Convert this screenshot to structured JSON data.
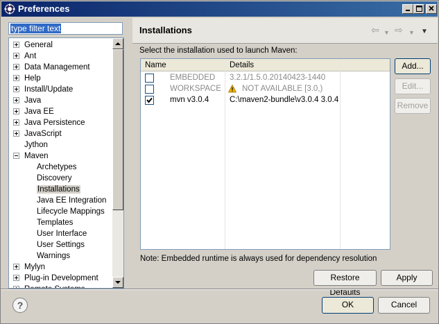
{
  "window": {
    "title": "Preferences"
  },
  "filter": {
    "value": "type filter text"
  },
  "tree": {
    "items": [
      {
        "label": "General",
        "expander": "plus"
      },
      {
        "label": "Ant",
        "expander": "plus"
      },
      {
        "label": "Data Management",
        "expander": "plus"
      },
      {
        "label": "Help",
        "expander": "plus"
      },
      {
        "label": "Install/Update",
        "expander": "plus"
      },
      {
        "label": "Java",
        "expander": "plus"
      },
      {
        "label": "Java EE",
        "expander": "plus"
      },
      {
        "label": "Java Persistence",
        "expander": "plus"
      },
      {
        "label": "JavaScript",
        "expander": "plus"
      },
      {
        "label": "Jython",
        "expander": "none"
      },
      {
        "label": "Maven",
        "expander": "minus"
      },
      {
        "label": "Archetypes",
        "expander": "child"
      },
      {
        "label": "Discovery",
        "expander": "child"
      },
      {
        "label": "Installations",
        "expander": "child",
        "selected": true
      },
      {
        "label": "Java EE Integration",
        "expander": "child"
      },
      {
        "label": "Lifecycle Mappings",
        "expander": "child"
      },
      {
        "label": "Templates",
        "expander": "child"
      },
      {
        "label": "User Interface",
        "expander": "child"
      },
      {
        "label": "User Settings",
        "expander": "child"
      },
      {
        "label": "Warnings",
        "expander": "child"
      },
      {
        "label": "Mylyn",
        "expander": "plus"
      },
      {
        "label": "Plug-in Development",
        "expander": "plus"
      },
      {
        "label": "Remote Systems",
        "expander": "plus"
      }
    ]
  },
  "page": {
    "title": "Installations",
    "instruction": "Select the installation used to launch Maven:",
    "note": "Note: Embedded runtime is always used for dependency resolution"
  },
  "table": {
    "columns": [
      "Name",
      "Details"
    ],
    "rows": [
      {
        "name": "EMBEDDED",
        "details": "3.2.1/1.5.0.20140423-1440",
        "checked": false,
        "gray": true,
        "warning": false
      },
      {
        "name": "WORKSPACE",
        "details": "NOT AVAILABLE [3.0,)",
        "checked": false,
        "gray": true,
        "warning": true
      },
      {
        "name": "mvn v3.0.4",
        "details": "C:\\maven2-bundle\\v3.0.4 3.0.4",
        "checked": true,
        "gray": false,
        "warning": false
      }
    ]
  },
  "buttons": {
    "add": "Add...",
    "edit": "Edit...",
    "remove": "Remove",
    "restore_defaults": "Restore Defaults",
    "apply": "Apply",
    "ok": "OK",
    "cancel": "Cancel",
    "help": "?"
  },
  "icons": {
    "app": "eclipse-gear-icon",
    "back": "back-arrow-icon",
    "forward": "forward-arrow-icon",
    "menu": "view-menu-icon",
    "warning": "warning-icon"
  },
  "colors": {
    "titlebar_start": "#0a246a",
    "titlebar_end": "#3a6ea5",
    "selection": "#316ac5",
    "warning": "#f0b400"
  }
}
